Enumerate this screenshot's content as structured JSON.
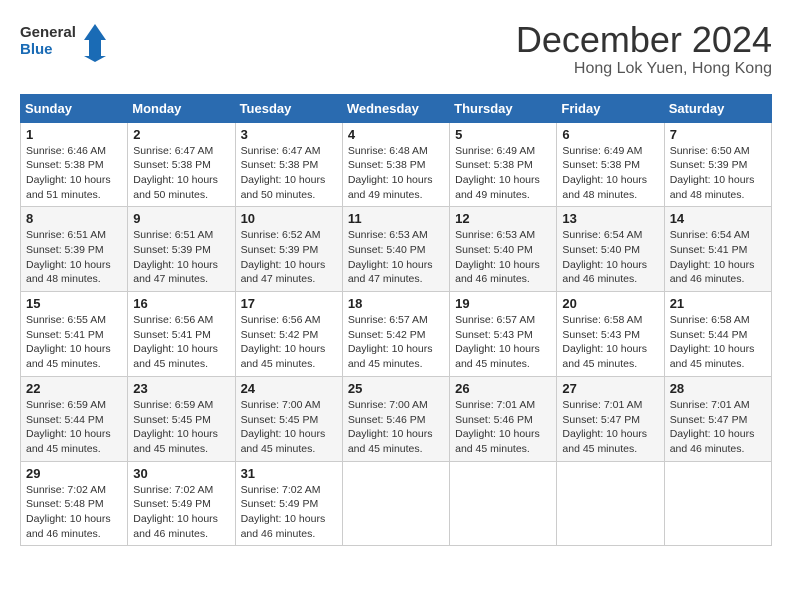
{
  "header": {
    "logo_line1": "General",
    "logo_line2": "Blue",
    "month": "December 2024",
    "location": "Hong Lok Yuen, Hong Kong"
  },
  "days_of_week": [
    "Sunday",
    "Monday",
    "Tuesday",
    "Wednesday",
    "Thursday",
    "Friday",
    "Saturday"
  ],
  "weeks": [
    [
      {
        "day": "1",
        "info": "Sunrise: 6:46 AM\nSunset: 5:38 PM\nDaylight: 10 hours\nand 51 minutes."
      },
      {
        "day": "2",
        "info": "Sunrise: 6:47 AM\nSunset: 5:38 PM\nDaylight: 10 hours\nand 50 minutes."
      },
      {
        "day": "3",
        "info": "Sunrise: 6:47 AM\nSunset: 5:38 PM\nDaylight: 10 hours\nand 50 minutes."
      },
      {
        "day": "4",
        "info": "Sunrise: 6:48 AM\nSunset: 5:38 PM\nDaylight: 10 hours\nand 49 minutes."
      },
      {
        "day": "5",
        "info": "Sunrise: 6:49 AM\nSunset: 5:38 PM\nDaylight: 10 hours\nand 49 minutes."
      },
      {
        "day": "6",
        "info": "Sunrise: 6:49 AM\nSunset: 5:38 PM\nDaylight: 10 hours\nand 48 minutes."
      },
      {
        "day": "7",
        "info": "Sunrise: 6:50 AM\nSunset: 5:39 PM\nDaylight: 10 hours\nand 48 minutes."
      }
    ],
    [
      {
        "day": "8",
        "info": "Sunrise: 6:51 AM\nSunset: 5:39 PM\nDaylight: 10 hours\nand 48 minutes."
      },
      {
        "day": "9",
        "info": "Sunrise: 6:51 AM\nSunset: 5:39 PM\nDaylight: 10 hours\nand 47 minutes."
      },
      {
        "day": "10",
        "info": "Sunrise: 6:52 AM\nSunset: 5:39 PM\nDaylight: 10 hours\nand 47 minutes."
      },
      {
        "day": "11",
        "info": "Sunrise: 6:53 AM\nSunset: 5:40 PM\nDaylight: 10 hours\nand 47 minutes."
      },
      {
        "day": "12",
        "info": "Sunrise: 6:53 AM\nSunset: 5:40 PM\nDaylight: 10 hours\nand 46 minutes."
      },
      {
        "day": "13",
        "info": "Sunrise: 6:54 AM\nSunset: 5:40 PM\nDaylight: 10 hours\nand 46 minutes."
      },
      {
        "day": "14",
        "info": "Sunrise: 6:54 AM\nSunset: 5:41 PM\nDaylight: 10 hours\nand 46 minutes."
      }
    ],
    [
      {
        "day": "15",
        "info": "Sunrise: 6:55 AM\nSunset: 5:41 PM\nDaylight: 10 hours\nand 45 minutes."
      },
      {
        "day": "16",
        "info": "Sunrise: 6:56 AM\nSunset: 5:41 PM\nDaylight: 10 hours\nand 45 minutes."
      },
      {
        "day": "17",
        "info": "Sunrise: 6:56 AM\nSunset: 5:42 PM\nDaylight: 10 hours\nand 45 minutes."
      },
      {
        "day": "18",
        "info": "Sunrise: 6:57 AM\nSunset: 5:42 PM\nDaylight: 10 hours\nand 45 minutes."
      },
      {
        "day": "19",
        "info": "Sunrise: 6:57 AM\nSunset: 5:43 PM\nDaylight: 10 hours\nand 45 minutes."
      },
      {
        "day": "20",
        "info": "Sunrise: 6:58 AM\nSunset: 5:43 PM\nDaylight: 10 hours\nand 45 minutes."
      },
      {
        "day": "21",
        "info": "Sunrise: 6:58 AM\nSunset: 5:44 PM\nDaylight: 10 hours\nand 45 minutes."
      }
    ],
    [
      {
        "day": "22",
        "info": "Sunrise: 6:59 AM\nSunset: 5:44 PM\nDaylight: 10 hours\nand 45 minutes."
      },
      {
        "day": "23",
        "info": "Sunrise: 6:59 AM\nSunset: 5:45 PM\nDaylight: 10 hours\nand 45 minutes."
      },
      {
        "day": "24",
        "info": "Sunrise: 7:00 AM\nSunset: 5:45 PM\nDaylight: 10 hours\nand 45 minutes."
      },
      {
        "day": "25",
        "info": "Sunrise: 7:00 AM\nSunset: 5:46 PM\nDaylight: 10 hours\nand 45 minutes."
      },
      {
        "day": "26",
        "info": "Sunrise: 7:01 AM\nSunset: 5:46 PM\nDaylight: 10 hours\nand 45 minutes."
      },
      {
        "day": "27",
        "info": "Sunrise: 7:01 AM\nSunset: 5:47 PM\nDaylight: 10 hours\nand 45 minutes."
      },
      {
        "day": "28",
        "info": "Sunrise: 7:01 AM\nSunset: 5:47 PM\nDaylight: 10 hours\nand 46 minutes."
      }
    ],
    [
      {
        "day": "29",
        "info": "Sunrise: 7:02 AM\nSunset: 5:48 PM\nDaylight: 10 hours\nand 46 minutes."
      },
      {
        "day": "30",
        "info": "Sunrise: 7:02 AM\nSunset: 5:49 PM\nDaylight: 10 hours\nand 46 minutes."
      },
      {
        "day": "31",
        "info": "Sunrise: 7:02 AM\nSunset: 5:49 PM\nDaylight: 10 hours\nand 46 minutes."
      },
      null,
      null,
      null,
      null
    ]
  ]
}
